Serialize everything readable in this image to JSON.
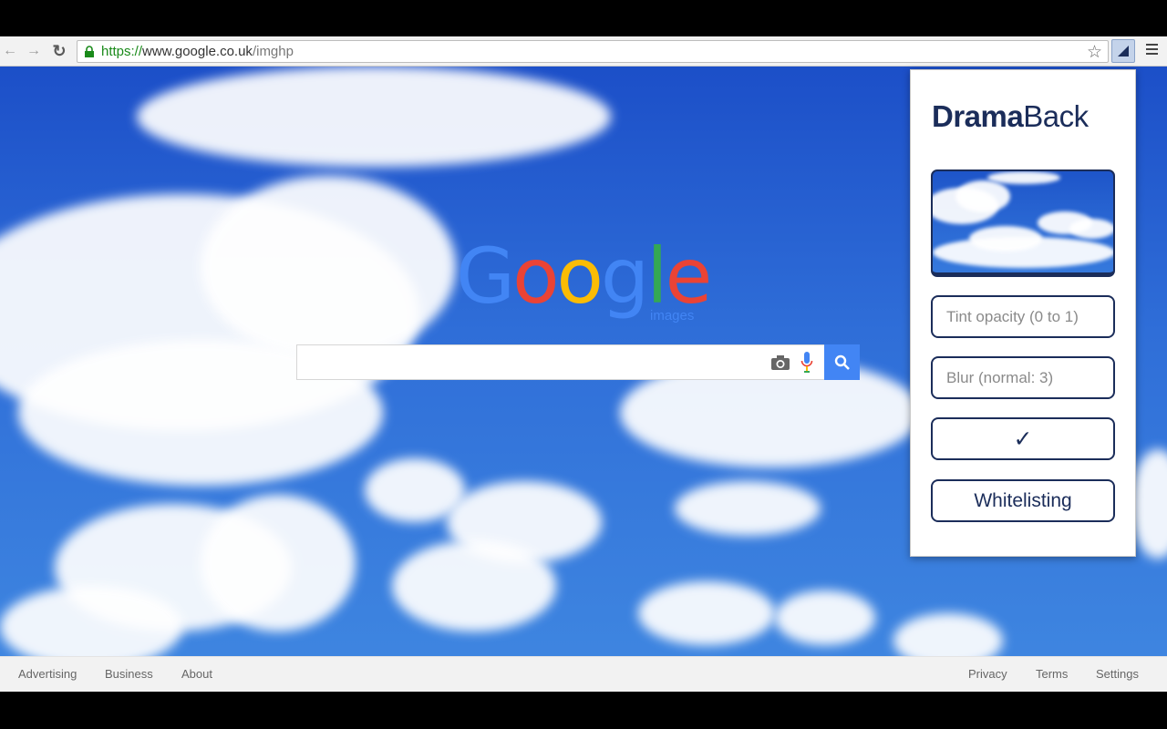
{
  "browser": {
    "url_scheme": "https://",
    "url_host": "www.google.co.uk",
    "url_path": "/imghp",
    "nav_back_icon": "arrow-left",
    "nav_forward_icon": "arrow-right",
    "reload_icon": "reload",
    "bookmark_icon": "star-outline",
    "extension_icon": "dramaback-triangle",
    "menu_icon": "hamburger"
  },
  "google": {
    "logo_letters": [
      "G",
      "o",
      "o",
      "g",
      "l",
      "e"
    ],
    "logo_sub": "images",
    "search_value": "",
    "camera_icon": "camera",
    "mic_icon": "microphone",
    "search_icon": "magnifier"
  },
  "footer": {
    "left_links": [
      "Advertising",
      "Business",
      "About"
    ],
    "right_links": [
      "Privacy",
      "Terms",
      "Settings"
    ]
  },
  "popup": {
    "brand_bold": "Drama",
    "brand_regular": "Back",
    "tint_placeholder": "Tint opacity (0 to 1)",
    "blur_placeholder": "Blur (normal: 3)",
    "apply_label": "✓",
    "whitelist_label": "Whitelisting"
  },
  "colors": {
    "brand_navy": "#1b2d5a",
    "google_blue": "#4285f4",
    "google_red": "#ea4335",
    "google_yellow": "#fbbc05",
    "google_green": "#34a853",
    "sky_blue": "#2f6ed8"
  }
}
